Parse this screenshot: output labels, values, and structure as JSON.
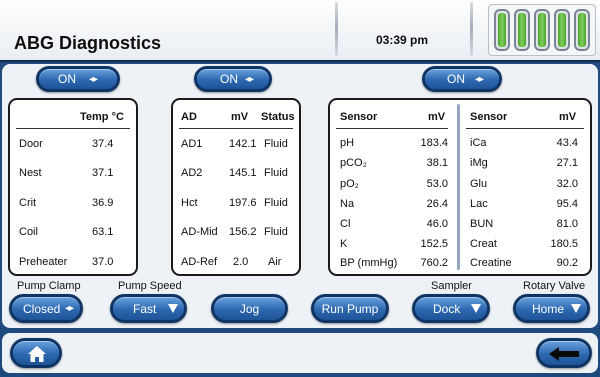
{
  "header": {
    "title": "ABG Diagnostics",
    "time": "03:39 pm",
    "battery_levels": [
      1,
      1,
      1,
      1,
      1
    ],
    "battery_color": "#5cb83a"
  },
  "toggles": [
    {
      "label": "ON"
    },
    {
      "label": "ON"
    },
    {
      "label": "ON"
    }
  ],
  "temperature": {
    "header_value": "Temp °C",
    "rows": [
      {
        "name": "Door",
        "value": "37.4"
      },
      {
        "name": "Nest",
        "value": "37.1"
      },
      {
        "name": "Crit",
        "value": "36.9"
      },
      {
        "name": "Coil",
        "value": "63.1"
      },
      {
        "name": "Preheater",
        "value": "37.0"
      }
    ]
  },
  "ad": {
    "headers": [
      "AD",
      "mV",
      "Status"
    ],
    "rows": [
      {
        "name": "AD1",
        "mv": "142.1",
        "status": "Fluid"
      },
      {
        "name": "AD2",
        "mv": "145.1",
        "status": "Fluid"
      },
      {
        "name": "Hct",
        "mv": "197.6",
        "status": "Fluid"
      },
      {
        "name": "AD-Mid",
        "mv": "156.2",
        "status": "Fluid"
      },
      {
        "name": "AD-Ref",
        "mv": "2.0",
        "status": "Air"
      }
    ]
  },
  "sensors": {
    "headers": [
      "Sensor",
      "mV",
      "Sensor",
      "mV"
    ],
    "left": [
      {
        "name": "pH",
        "mv": "183.4"
      },
      {
        "name": "pCO₂",
        "mv": "38.1"
      },
      {
        "name": "pO₂",
        "mv": "53.0"
      },
      {
        "name": "Na",
        "mv": "26.4"
      },
      {
        "name": "Cl",
        "mv": "46.0"
      },
      {
        "name": "K",
        "mv": "152.5"
      },
      {
        "name": "BP (mmHg)",
        "mv": "760.2"
      }
    ],
    "right": [
      {
        "name": "iCa",
        "mv": "43.4"
      },
      {
        "name": "iMg",
        "mv": "27.1"
      },
      {
        "name": "Glu",
        "mv": "32.0"
      },
      {
        "name": "Lac",
        "mv": "95.4"
      },
      {
        "name": "BUN",
        "mv": "81.0"
      },
      {
        "name": "Creat",
        "mv": "180.5"
      },
      {
        "name": "Creatine",
        "mv": "90.2"
      }
    ]
  },
  "controls": {
    "pump_clamp": {
      "caption": "Pump Clamp",
      "value": "Closed"
    },
    "pump_speed": {
      "caption": "Pump Speed",
      "value": "Fast"
    },
    "jog": {
      "label": "Jog"
    },
    "run_pump": {
      "label": "Run Pump"
    },
    "sampler": {
      "caption": "Sampler",
      "value": "Dock"
    },
    "rotary_valve": {
      "caption": "Rotary Valve",
      "value": "Home"
    }
  },
  "nav": {
    "home_icon": "home-icon",
    "back_icon": "back-arrow-icon"
  }
}
